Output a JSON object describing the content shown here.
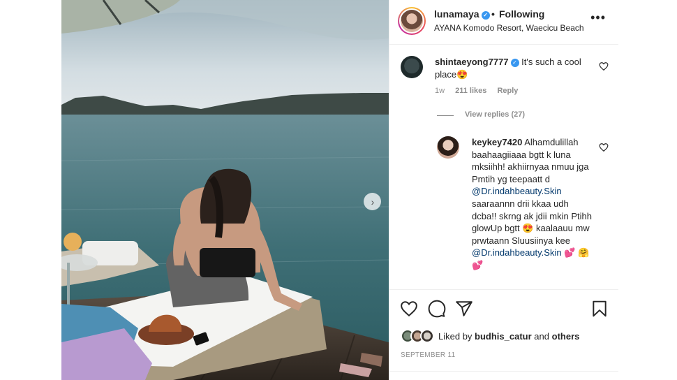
{
  "post": {
    "username": "lunamaya",
    "verified": true,
    "separator": "•",
    "follow_state": "Following",
    "location": "AYANA Komodo Resort, Waecicu Beach",
    "more_icon": "more-horizontal-icon"
  },
  "photo": {
    "next_icon": "chevron-right-icon",
    "next_glyph": "›"
  },
  "comments": [
    {
      "username": "shintaeyong7777",
      "verified": true,
      "text": "It's such a cool place😍",
      "age": "1w",
      "likes": "211 likes",
      "reply_label": "Reply",
      "view_replies": "View replies (27)"
    },
    {
      "username": "keykey7420",
      "text_parts": [
        "Alhamdulillah baahaagiiaaa bgtt k luna mksiihh! akhiirnyaa nmuu jga Pmtih yg teepaatt d ",
        "@Dr.indahbeauty.Skin",
        " saaraannn drii kkaa udh dcba!! skrng ak jdii mkin Ptihh glowUp bgtt 😍 kaalaauu mw prwtaann Sluusiinya kee ",
        "@Dr.indahbeauty.Skin",
        " 💕 🤗 💕"
      ]
    }
  ],
  "actions": {
    "like_icon": "heart-icon",
    "comment_icon": "comment-icon",
    "share_icon": "send-icon",
    "save_icon": "bookmark-icon"
  },
  "likes": {
    "prefix": "Liked by",
    "user": "budhis_catur",
    "connector": "and",
    "others": "others"
  },
  "date": "SEPTEMBER 11",
  "colors": {
    "verified_blue": "#3897f0",
    "mention": "#00376b",
    "secondary_text": "#8e8e8e",
    "text": "#262626"
  }
}
